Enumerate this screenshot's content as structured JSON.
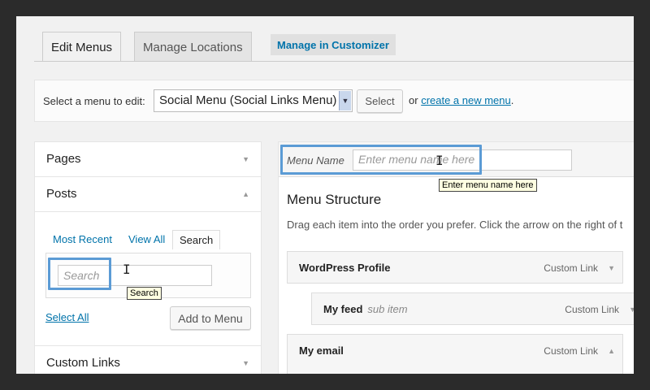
{
  "tabs": [
    {
      "label": "Edit Menus"
    },
    {
      "label": "Manage Locations"
    }
  ],
  "customizer_link": "Manage in Customizer",
  "select_bar": {
    "label": "Select a menu to edit:",
    "selected_menu": "Social Menu (Social Links Menu)",
    "select_button": "Select",
    "or_text": "or",
    "create_link": "create a new menu",
    "period": "."
  },
  "left_panel": {
    "pages_title": "Pages",
    "posts_title": "Posts",
    "tabs": [
      "Most Recent",
      "View All",
      "Search"
    ],
    "search_placeholder": "Search",
    "search_tooltip": "Search",
    "select_all": "Select All",
    "add_to_menu": "Add to Menu",
    "custom_links_title": "Custom Links"
  },
  "right_panel": {
    "menu_name_label": "Menu Name",
    "menu_name_placeholder": "Enter menu name here",
    "menu_name_tooltip": "Enter menu name here",
    "structure_title": "Menu Structure",
    "structure_desc": "Drag each item into the order you prefer. Click the arrow on the right of t",
    "items": [
      {
        "title": "WordPress Profile",
        "subtitle": "",
        "kind": "Custom Link"
      },
      {
        "title": "My feed",
        "subtitle": "sub item",
        "kind": "Custom Link"
      },
      {
        "title": "My email",
        "subtitle": "",
        "kind": "Custom Link"
      }
    ]
  },
  "colors": {
    "link": "#0073aa",
    "highlight": "#5b9bd5",
    "tooltip_bg": "#ffffe1"
  }
}
